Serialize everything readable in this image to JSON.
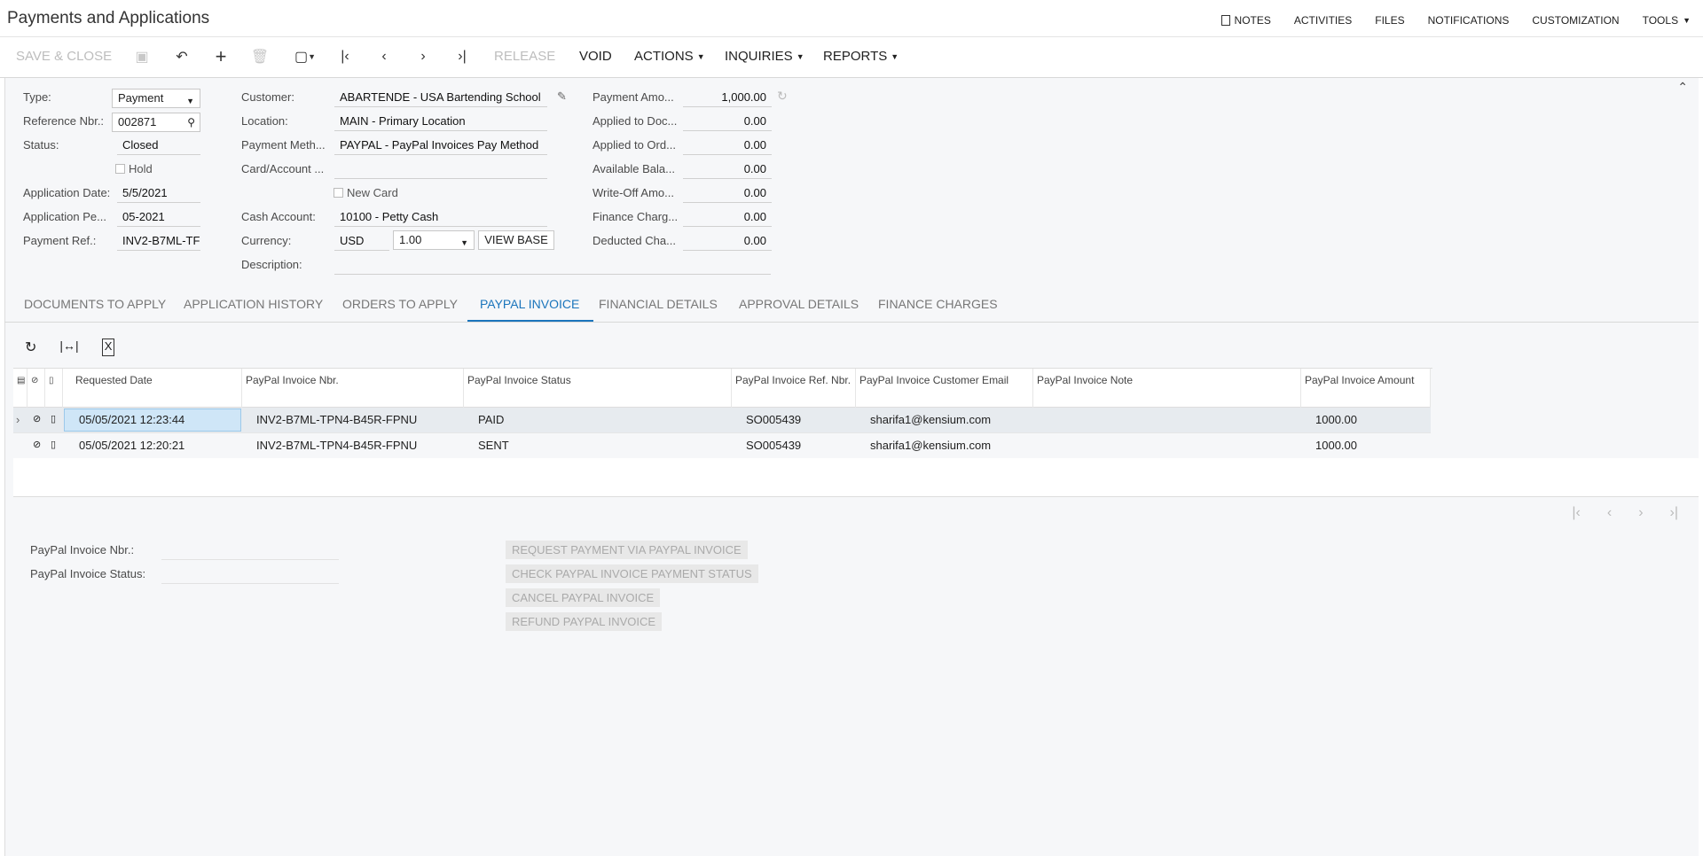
{
  "app": {
    "title": "Payments and Applications"
  },
  "top_links": [
    "NOTES",
    "ACTIVITIES",
    "FILES",
    "NOTIFICATIONS",
    "CUSTOMIZATION",
    "TOOLS"
  ],
  "toolbar": {
    "save_close": "SAVE & CLOSE",
    "release": "RELEASE",
    "void": "VOID",
    "actions": "ACTIONS",
    "inquiries": "INQUIRIES",
    "reports": "REPORTS"
  },
  "form": {
    "type_label": "Type:",
    "type_value": "Payment",
    "ref_label": "Reference Nbr.:",
    "ref_value": "002871",
    "status_label": "Status:",
    "status_value": "Closed",
    "hold_label": "Hold",
    "app_date_label": "Application Date:",
    "app_date_value": "5/5/2021",
    "app_period_label": "Application Pe...",
    "app_period_value": "05-2021",
    "payment_ref_label": "Payment Ref.:",
    "payment_ref_value": "INV2-B7ML-TF",
    "customer_label": "Customer:",
    "customer_value": "ABARTENDE - USA Bartending School",
    "location_label": "Location:",
    "location_value": "MAIN - Primary Location",
    "pay_method_label": "Payment Meth...",
    "pay_method_value": "PAYPAL - PayPal Invoices Pay Method",
    "card_label": "Card/Account ...",
    "card_value": "",
    "new_card_label": "New Card",
    "cash_account_label": "Cash Account:",
    "cash_account_value": "10100 - Petty Cash",
    "currency_label": "Currency:",
    "currency_value": "USD",
    "rate_value": "1.00",
    "view_base": "VIEW BASE",
    "description_label": "Description:",
    "description_value": "",
    "payment_amount_label": "Payment Amo...",
    "payment_amount_value": "1,000.00",
    "applied_doc_label": "Applied to Doc...",
    "applied_doc_value": "0.00",
    "applied_ord_label": "Applied to Ord...",
    "applied_ord_value": "0.00",
    "available_label": "Available Bala...",
    "available_value": "0.00",
    "writeoff_label": "Write-Off Amo...",
    "writeoff_value": "0.00",
    "finance_label": "Finance Charg...",
    "finance_value": "0.00",
    "deducted_label": "Deducted Cha...",
    "deducted_value": "0.00"
  },
  "tabs": [
    "DOCUMENTS TO APPLY",
    "APPLICATION HISTORY",
    "ORDERS TO APPLY",
    "PAYPAL INVOICE",
    "FINANCIAL DETAILS",
    "APPROVAL DETAILS",
    "FINANCE CHARGES"
  ],
  "active_tab": "PAYPAL INVOICE",
  "grid": {
    "columns": [
      "Requested Date",
      "PayPal Invoice Nbr.",
      "PayPal Invoice Status",
      "PayPal Invoice Ref. Nbr.",
      "PayPal Invoice Customer Email",
      "PayPal Invoice Note",
      "PayPal Invoice Amount"
    ],
    "rows": [
      {
        "date": "05/05/2021 12:23:44",
        "nbr": "INV2-B7ML-TPN4-B45R-FPNU",
        "status": "PAID",
        "ref": "SO005439",
        "email": "sharifa1@kensium.com",
        "note": "",
        "amount": "1000.00"
      },
      {
        "date": "05/05/2021 12:20:21",
        "nbr": "INV2-B7ML-TPN4-B45R-FPNU",
        "status": "SENT",
        "ref": "SO005439",
        "email": "sharifa1@kensium.com",
        "note": "",
        "amount": "1000.00"
      }
    ]
  },
  "detail": {
    "nbr_label": "PayPal Invoice Nbr.:",
    "nbr_value": "",
    "status_label": "PayPal Invoice Status:",
    "status_value": "",
    "btn_request": "REQUEST PAYMENT VIA PAYPAL INVOICE",
    "btn_check": "CHECK PAYPAL INVOICE PAYMENT STATUS",
    "btn_cancel": "CANCEL PAYPAL INVOICE",
    "btn_refund": "REFUND PAYPAL INVOICE"
  },
  "colors": {
    "accent": "#1b75bc",
    "selected_cell": "#cfe6f7",
    "row_highlight": "#e7ebef"
  }
}
